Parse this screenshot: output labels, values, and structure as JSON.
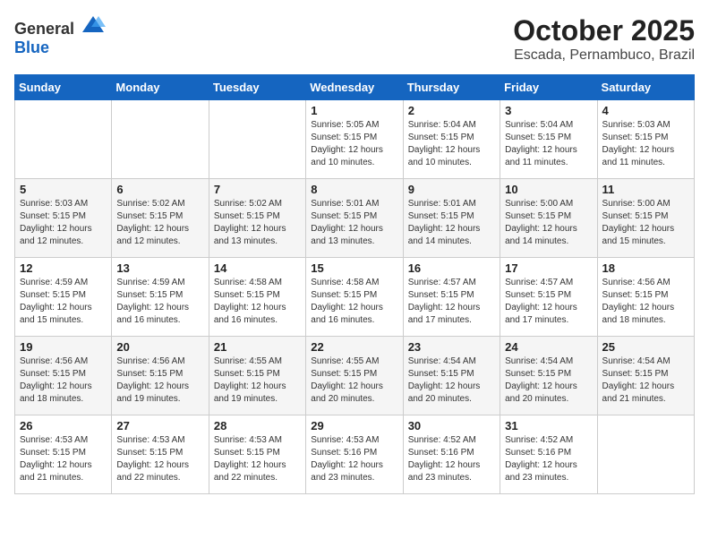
{
  "header": {
    "logo_general": "General",
    "logo_blue": "Blue",
    "month_title": "October 2025",
    "subtitle": "Escada, Pernambuco, Brazil"
  },
  "calendar": {
    "days_of_week": [
      "Sunday",
      "Monday",
      "Tuesday",
      "Wednesday",
      "Thursday",
      "Friday",
      "Saturday"
    ],
    "weeks": [
      [
        {
          "day": "",
          "info": ""
        },
        {
          "day": "",
          "info": ""
        },
        {
          "day": "",
          "info": ""
        },
        {
          "day": "1",
          "info": "Sunrise: 5:05 AM\nSunset: 5:15 PM\nDaylight: 12 hours\nand 10 minutes."
        },
        {
          "day": "2",
          "info": "Sunrise: 5:04 AM\nSunset: 5:15 PM\nDaylight: 12 hours\nand 10 minutes."
        },
        {
          "day": "3",
          "info": "Sunrise: 5:04 AM\nSunset: 5:15 PM\nDaylight: 12 hours\nand 11 minutes."
        },
        {
          "day": "4",
          "info": "Sunrise: 5:03 AM\nSunset: 5:15 PM\nDaylight: 12 hours\nand 11 minutes."
        }
      ],
      [
        {
          "day": "5",
          "info": "Sunrise: 5:03 AM\nSunset: 5:15 PM\nDaylight: 12 hours\nand 12 minutes."
        },
        {
          "day": "6",
          "info": "Sunrise: 5:02 AM\nSunset: 5:15 PM\nDaylight: 12 hours\nand 12 minutes."
        },
        {
          "day": "7",
          "info": "Sunrise: 5:02 AM\nSunset: 5:15 PM\nDaylight: 12 hours\nand 13 minutes."
        },
        {
          "day": "8",
          "info": "Sunrise: 5:01 AM\nSunset: 5:15 PM\nDaylight: 12 hours\nand 13 minutes."
        },
        {
          "day": "9",
          "info": "Sunrise: 5:01 AM\nSunset: 5:15 PM\nDaylight: 12 hours\nand 14 minutes."
        },
        {
          "day": "10",
          "info": "Sunrise: 5:00 AM\nSunset: 5:15 PM\nDaylight: 12 hours\nand 14 minutes."
        },
        {
          "day": "11",
          "info": "Sunrise: 5:00 AM\nSunset: 5:15 PM\nDaylight: 12 hours\nand 15 minutes."
        }
      ],
      [
        {
          "day": "12",
          "info": "Sunrise: 4:59 AM\nSunset: 5:15 PM\nDaylight: 12 hours\nand 15 minutes."
        },
        {
          "day": "13",
          "info": "Sunrise: 4:59 AM\nSunset: 5:15 PM\nDaylight: 12 hours\nand 16 minutes."
        },
        {
          "day": "14",
          "info": "Sunrise: 4:58 AM\nSunset: 5:15 PM\nDaylight: 12 hours\nand 16 minutes."
        },
        {
          "day": "15",
          "info": "Sunrise: 4:58 AM\nSunset: 5:15 PM\nDaylight: 12 hours\nand 16 minutes."
        },
        {
          "day": "16",
          "info": "Sunrise: 4:57 AM\nSunset: 5:15 PM\nDaylight: 12 hours\nand 17 minutes."
        },
        {
          "day": "17",
          "info": "Sunrise: 4:57 AM\nSunset: 5:15 PM\nDaylight: 12 hours\nand 17 minutes."
        },
        {
          "day": "18",
          "info": "Sunrise: 4:56 AM\nSunset: 5:15 PM\nDaylight: 12 hours\nand 18 minutes."
        }
      ],
      [
        {
          "day": "19",
          "info": "Sunrise: 4:56 AM\nSunset: 5:15 PM\nDaylight: 12 hours\nand 18 minutes."
        },
        {
          "day": "20",
          "info": "Sunrise: 4:56 AM\nSunset: 5:15 PM\nDaylight: 12 hours\nand 19 minutes."
        },
        {
          "day": "21",
          "info": "Sunrise: 4:55 AM\nSunset: 5:15 PM\nDaylight: 12 hours\nand 19 minutes."
        },
        {
          "day": "22",
          "info": "Sunrise: 4:55 AM\nSunset: 5:15 PM\nDaylight: 12 hours\nand 20 minutes."
        },
        {
          "day": "23",
          "info": "Sunrise: 4:54 AM\nSunset: 5:15 PM\nDaylight: 12 hours\nand 20 minutes."
        },
        {
          "day": "24",
          "info": "Sunrise: 4:54 AM\nSunset: 5:15 PM\nDaylight: 12 hours\nand 20 minutes."
        },
        {
          "day": "25",
          "info": "Sunrise: 4:54 AM\nSunset: 5:15 PM\nDaylight: 12 hours\nand 21 minutes."
        }
      ],
      [
        {
          "day": "26",
          "info": "Sunrise: 4:53 AM\nSunset: 5:15 PM\nDaylight: 12 hours\nand 21 minutes."
        },
        {
          "day": "27",
          "info": "Sunrise: 4:53 AM\nSunset: 5:15 PM\nDaylight: 12 hours\nand 22 minutes."
        },
        {
          "day": "28",
          "info": "Sunrise: 4:53 AM\nSunset: 5:15 PM\nDaylight: 12 hours\nand 22 minutes."
        },
        {
          "day": "29",
          "info": "Sunrise: 4:53 AM\nSunset: 5:16 PM\nDaylight: 12 hours\nand 23 minutes."
        },
        {
          "day": "30",
          "info": "Sunrise: 4:52 AM\nSunset: 5:16 PM\nDaylight: 12 hours\nand 23 minutes."
        },
        {
          "day": "31",
          "info": "Sunrise: 4:52 AM\nSunset: 5:16 PM\nDaylight: 12 hours\nand 23 minutes."
        },
        {
          "day": "",
          "info": ""
        }
      ]
    ]
  }
}
